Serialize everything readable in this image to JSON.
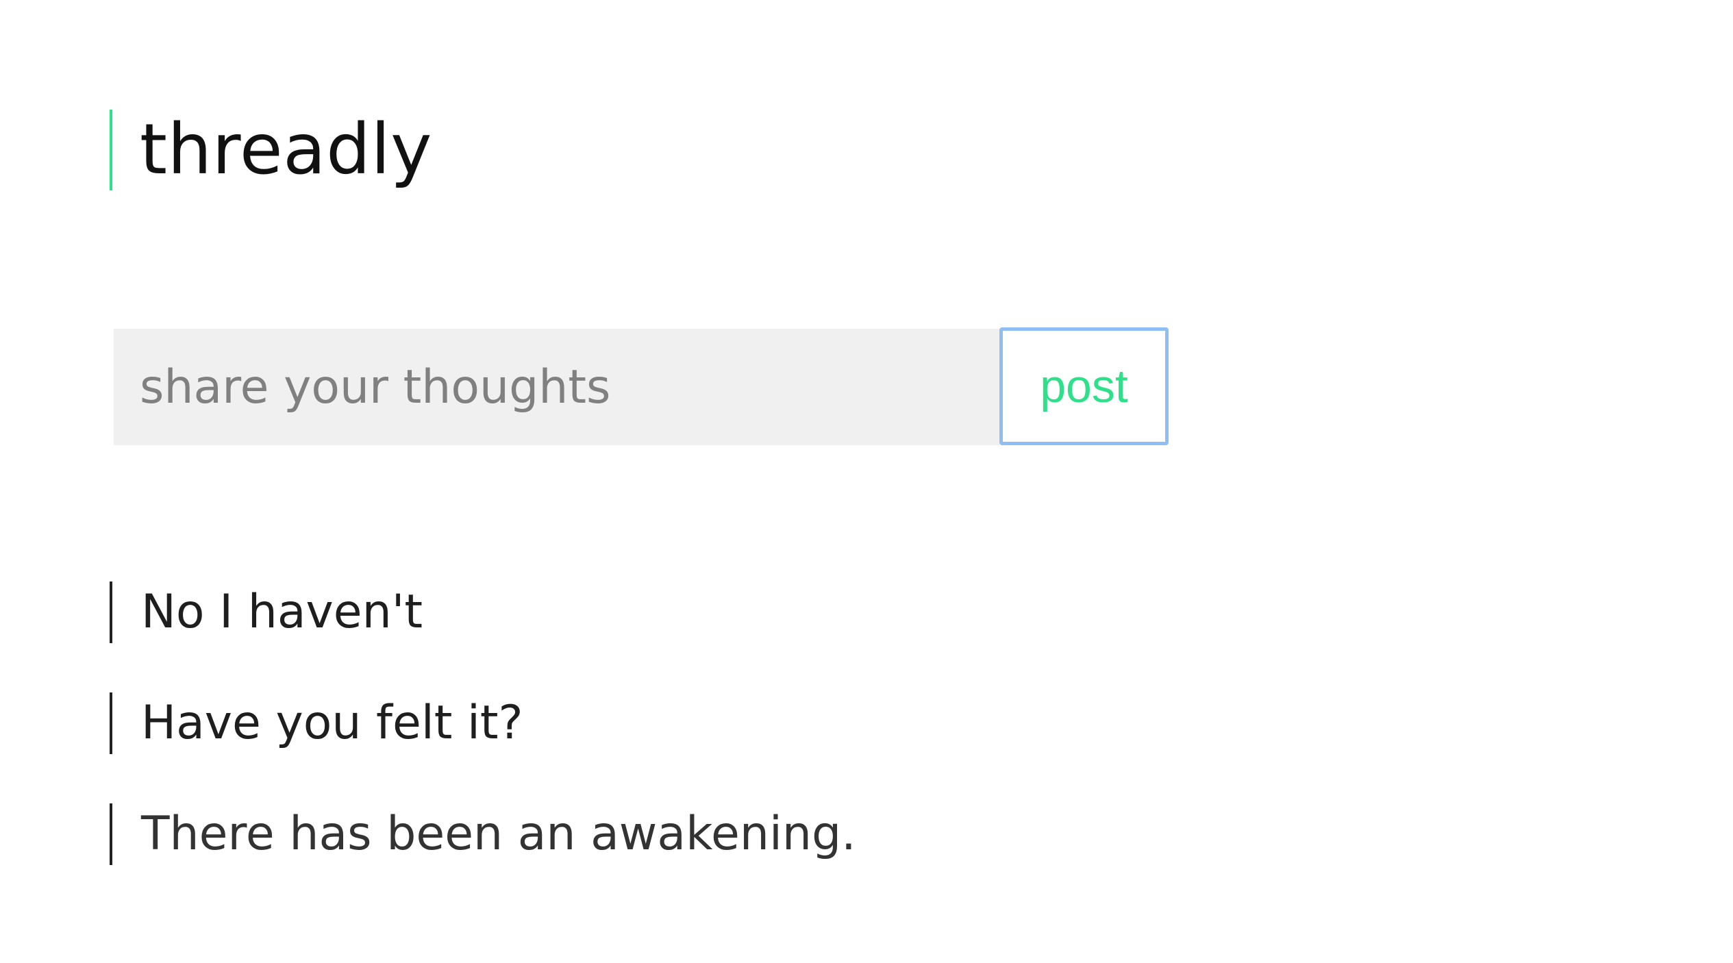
{
  "theme": {
    "accent": "#2fe08a",
    "input_background": "#f0f0f0",
    "button_border": "#8fbef5"
  },
  "header": {
    "title": "threadly"
  },
  "composer": {
    "placeholder": "share your thoughts",
    "value": "",
    "post_label": "post"
  },
  "threads": [
    {
      "text": "No I haven't"
    },
    {
      "text": "Have you felt it?"
    },
    {
      "text": "There has been an awakening."
    }
  ]
}
